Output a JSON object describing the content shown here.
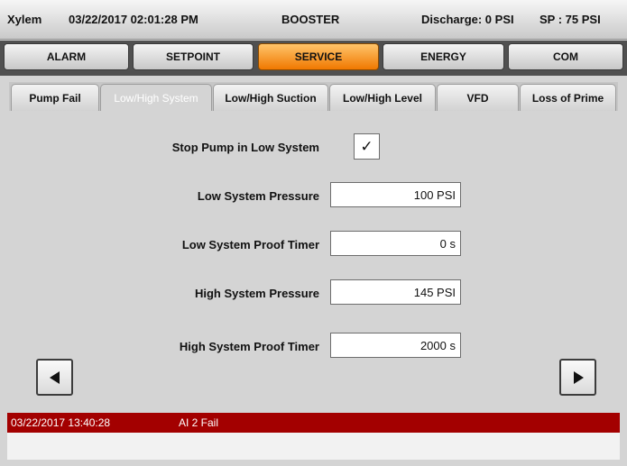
{
  "header": {
    "brand": "Xylem",
    "datetime": "03/22/2017 02:01:28 PM",
    "mode": "BOOSTER",
    "discharge": "Discharge: 0 PSI",
    "setpoint": "SP : 75 PSI"
  },
  "menu": [
    {
      "label": "ALARM",
      "active": false
    },
    {
      "label": "SETPOINT",
      "active": false
    },
    {
      "label": "SERVICE",
      "active": true
    },
    {
      "label": "ENERGY",
      "active": false
    },
    {
      "label": "COM",
      "active": false
    }
  ],
  "tabs": [
    {
      "label": "Pump Fail",
      "active": false
    },
    {
      "label": "Low/High System",
      "active": true
    },
    {
      "label": "Low/High Suction",
      "active": false
    },
    {
      "label": "Low/High Level",
      "active": false
    },
    {
      "label": "VFD",
      "active": false
    },
    {
      "label": "Loss of Prime",
      "active": false
    }
  ],
  "settings": {
    "stop_pump_label": "Stop Pump in Low System",
    "stop_pump_checked": true,
    "check_glyph": "✓",
    "low_pressure_label": "Low System Pressure",
    "low_pressure_value": "100 PSI",
    "low_timer_label": "Low System Proof Timer",
    "low_timer_value": "0 s",
    "high_pressure_label": "High System Pressure",
    "high_pressure_value": "145 PSI",
    "high_timer_label": "High System Proof Timer",
    "high_timer_value": "2000 s"
  },
  "nav": {
    "prev_icon": "left-triangle-icon",
    "next_icon": "right-triangle-icon"
  },
  "alarm": {
    "timestamp": "03/22/2017 13:40:28",
    "message": "AI 2 Fail",
    "color": "#a30000"
  },
  "colors": {
    "active_menu": "#f07800",
    "alarm_bg": "#a30000"
  }
}
